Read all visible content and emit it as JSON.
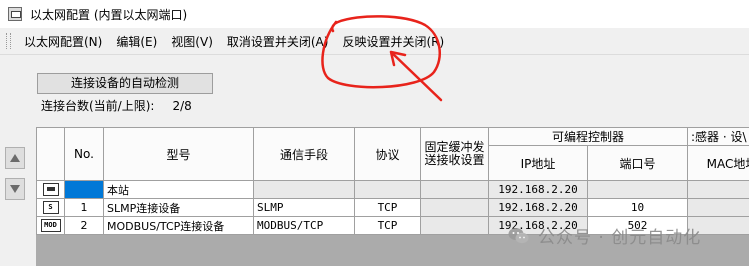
{
  "window": {
    "title": "以太网配置 (内置以太网端口)"
  },
  "menu": [
    {
      "label": "以太网配置(N)"
    },
    {
      "label": "编辑(E)"
    },
    {
      "label": "视图(V)"
    },
    {
      "label": "取消设置并关闭(A)"
    },
    {
      "label": "反映设置并关闭(R)"
    }
  ],
  "auto_detect_button": "连接设备的自动检测",
  "connection_count": {
    "label": "连接台数(当前/上限):",
    "value": "2/8"
  },
  "table": {
    "headers": {
      "no": "No.",
      "model": "型号",
      "comm_method": "通信手段",
      "protocol": "协议",
      "fixed_buffer": "固定缓冲发送接收设置",
      "plc_group": "可编程控制器",
      "sensor_group": ":感器 · 设\\",
      "ip": "IP地址",
      "port": "端口号",
      "mac": "MAC地址"
    },
    "rows": [
      {
        "icon": "station-icon",
        "icon_text": "",
        "no": "",
        "model": "本站",
        "comm_method": "",
        "protocol": "",
        "fixed_buffer": "",
        "ip": "192.168.2.20",
        "port": "",
        "mac": ""
      },
      {
        "icon": "slmp-device-icon",
        "icon_text": "S",
        "no": "1",
        "model": "SLMP连接设备",
        "comm_method": "SLMP",
        "protocol": "TCP",
        "fixed_buffer": "",
        "ip": "192.168.2.20",
        "port": "10",
        "mac": ""
      },
      {
        "icon": "modbus-device-icon",
        "icon_text": "MOD",
        "no": "2",
        "model": "MODBUS/TCP连接设备",
        "comm_method": "MODBUS/TCP",
        "protocol": "TCP",
        "fixed_buffer": "",
        "ip": "192.168.2.20",
        "port": "502",
        "mac": ""
      }
    ]
  },
  "watermark": "公众号 · 创元自动化",
  "annotation_color": "#e8231b"
}
